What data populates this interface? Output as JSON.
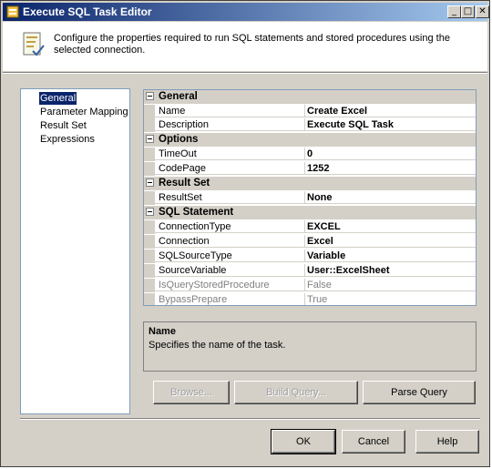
{
  "window": {
    "title": "Execute SQL Task Editor"
  },
  "header": {
    "description": "Configure the properties required to run SQL statements and stored procedures using the selected connection."
  },
  "nav": {
    "items": [
      "General",
      "Parameter Mapping",
      "Result Set",
      "Expressions"
    ],
    "selected": "General"
  },
  "grid": {
    "general": {
      "label": "General",
      "rows": [
        {
          "name": "Name",
          "value": "Create Excel"
        },
        {
          "name": "Description",
          "value": "Execute SQL Task"
        }
      ]
    },
    "options": {
      "label": "Options",
      "rows": [
        {
          "name": "TimeOut",
          "value": "0"
        },
        {
          "name": "CodePage",
          "value": "1252"
        }
      ]
    },
    "resultset": {
      "label": "Result Set",
      "rows": [
        {
          "name": "ResultSet",
          "value": "None"
        }
      ]
    },
    "sql": {
      "label": "SQL Statement",
      "rows": [
        {
          "name": "ConnectionType",
          "value": "EXCEL"
        },
        {
          "name": "Connection",
          "value": "Excel"
        },
        {
          "name": "SQLSourceType",
          "value": "Variable"
        },
        {
          "name": "SourceVariable",
          "value": "User::ExcelSheet"
        },
        {
          "name": "IsQueryStoredProcedure",
          "value": "False"
        },
        {
          "name": "BypassPrepare",
          "value": "True"
        }
      ]
    }
  },
  "description_panel": {
    "title": "Name",
    "text": "Specifies the name of the task."
  },
  "actions": {
    "browse": "Browse...",
    "build_query": "Build Query...",
    "parse_query": "Parse Query"
  },
  "footer": {
    "ok": "OK",
    "cancel": "Cancel",
    "help": "Help"
  },
  "colors": {
    "title_bar": "#0a246a",
    "dialog_face": "#d4d0c8",
    "selection": "#0a246a"
  }
}
